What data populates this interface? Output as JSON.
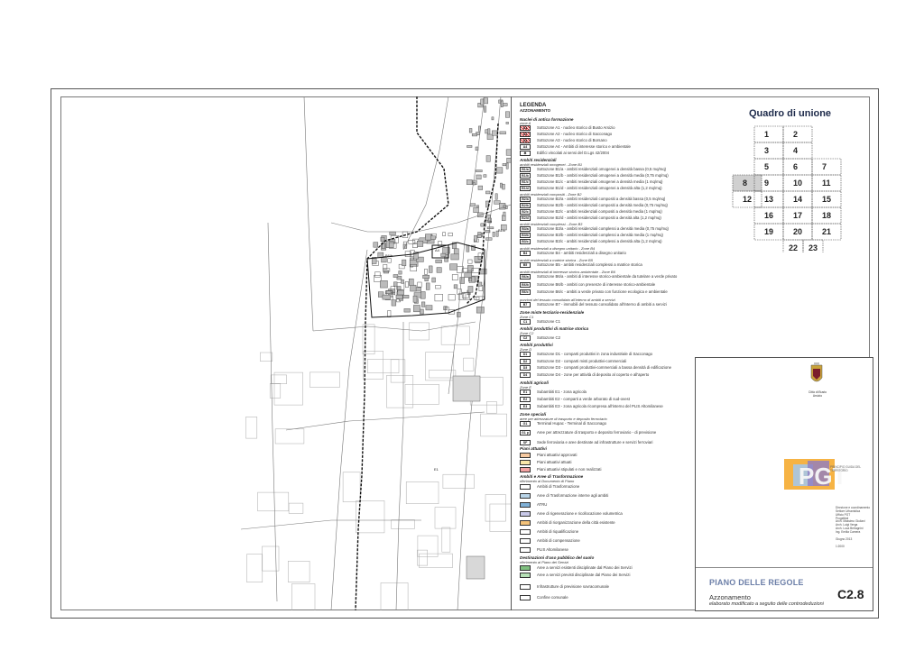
{
  "legend": {
    "title": "LEGENDA",
    "subtitle": "AZZONAMENTO",
    "groups": {
      "nuclei": "Nuclei di antica formazione",
      "zoneA": "zone A",
      "residenziali": "Ambiti residenziali",
      "omogenei": "ambiti residenziali omogenei - Zone B1",
      "compositi": "ambiti residenziali compositi - Zone B2",
      "complessi": "ambiti residenziali complessi - Zone B3",
      "disegno": "ambiti residenziali a disegno unitario - Zone B4",
      "matrice": "ambiti residenziali a matrice storica - Zone B5",
      "interesse": "ambiti residenziali di interesse storico-ambientale - Zone B6",
      "porzioni": "porzioni del tessuto consolidato all'interno di ambiti a servizi",
      "miste": "Zone miste terziario-residenziale",
      "zoneC1": "Zone C1",
      "produttivi_storica": "Ambiti produttivi di matrice storica",
      "zoneC2": "Zone C2",
      "produttivi": "Ambiti produttivi",
      "zoneD": "Zone D",
      "agricoli": "Ambiti agricoli",
      "zoneE": "Zone E",
      "speciali": "Zone speciali",
      "speciali_sub": "aree per attrezzature di trasporto e deposito ferroviario",
      "attuativi": "Piani attuativi",
      "trasformazione": "Ambiti e Aree di Trasformazione",
      "trasf_sub": "riferimento al Documento di Piano",
      "destinazioni": "Destinazioni d'uso pubblico del suolo",
      "dest_sub": "riferimento al Piano dei Servizi"
    },
    "rows": [
      {
        "code": "A1",
        "label": "Sottozone A1 - nucleo storico di Busto Arsizio",
        "color": "#d33"
      },
      {
        "code": "A2",
        "label": "Sottozone A2 - nucleo storico di Sacconago",
        "color": "#d33"
      },
      {
        "code": "A3",
        "label": "Sottozone A3 - nucleo storico di Borsano",
        "color": "#d33"
      },
      {
        "code": "A4",
        "label": "Sottozone A4 - Ambiti di interesse storico e ambientale",
        "color": "#fff"
      },
      {
        "code": "✱",
        "label": "Edifici vincolati ai sensi del D.Lgs 42/2004",
        "color": "#fff"
      },
      {
        "code": "B1/a",
        "label": "Sottozone B1/a - ambiti residenziali omogenei a densità bassa (0,5 mq/mq)",
        "color": "#fff"
      },
      {
        "code": "B1/b",
        "label": "Sottozone B1/b - ambiti residenziali omogenei a densità media (0,75 mq/mq)",
        "color": "#fff"
      },
      {
        "code": "B1/c",
        "label": "Sottozone B1/c - ambiti residenziali omogenei a densità media (1 mq/mq)",
        "color": "#fff"
      },
      {
        "code": "B1/d",
        "label": "Sottozone B1/d - ambiti residenziali omogenei a densità alta (1,2 mq/mq)",
        "color": "#fff"
      },
      {
        "code": "B2/a",
        "label": "Sottozone B2/a - ambiti residenziali compositi a densità bassa (0,5 mq/mq)",
        "color": "#fff"
      },
      {
        "code": "B2/b",
        "label": "Sottozone B2/b - ambiti residenziali compositi a densità media (0,75 mq/mq)",
        "color": "#fff"
      },
      {
        "code": "B2/c",
        "label": "Sottozone B2/c - ambiti residenziali compositi a densità media (1 mq/mq)",
        "color": "#fff"
      },
      {
        "code": "B2/d",
        "label": "Sottozone B2/d - ambiti residenziali compositi a densità alta (1,2 mq/mq)",
        "color": "#fff"
      },
      {
        "code": "B3/a",
        "label": "Sottozone B3/a - ambiti residenziali complessi a densità media (0,75 mq/mq)",
        "color": "#fff"
      },
      {
        "code": "B3/b",
        "label": "Sottozone B3/b - ambiti residenziali complessi a densità media (1 mq/mq)",
        "color": "#fff"
      },
      {
        "code": "B3/c",
        "label": "Sottozone B3/c - ambiti residenziali complessi a densità alta (1,2 mq/mq)",
        "color": "#fff"
      },
      {
        "code": "B4",
        "label": "Sottozone B4 - ambiti residenziali a disegno unitario",
        "color": "#fff"
      },
      {
        "code": "B5",
        "label": "Sottozone B5 - ambiti residenziali complessi a matrice storica",
        "color": "#fff"
      },
      {
        "code": "B6/a",
        "label": "Sottozone B6/a - ambiti di interesse storico-ambientale da tutelare a verde privato",
        "color": "#fff"
      },
      {
        "code": "B6/b",
        "label": "Sottozone B6/b - ambiti con presenze di interesse storico-ambientale",
        "color": "#fff"
      },
      {
        "code": "B6/c",
        "label": "Sottozone B6/c - ambiti a verde privato con funzione ecologica e ambientale",
        "color": "#fff"
      },
      {
        "code": "B7",
        "label": "Sottozone B7 - immobili del tessuto consolidato all'interno di ambiti a servizi",
        "color": "#fff"
      },
      {
        "code": "C1",
        "label": "Sottozone C1",
        "color": "#fff"
      },
      {
        "code": "C2",
        "label": "Sottozone C2",
        "color": "#fff"
      },
      {
        "code": "D1",
        "label": "Sottozone D1 - comparti produttivi in zona industriale di Sacconago",
        "color": "#fff"
      },
      {
        "code": "D2",
        "label": "Sottozone D2 - comparti misti produttivi-commerciali",
        "color": "#fff"
      },
      {
        "code": "D3",
        "label": "Sottozone D3 - comparti produttivi-commerciali a bassa densità di edificazione",
        "color": "#fff"
      },
      {
        "code": "D4",
        "label": "Sottozone D4 - zone per attività di deposito al coperto e all'aperto",
        "color": "#fff"
      },
      {
        "code": "E1",
        "label": "Subambiti E1 - zona agricola",
        "color": "#fff"
      },
      {
        "code": "E2",
        "label": "Subambiti E2 - comparti a verde arborato di sud-ovest",
        "color": "#fff"
      },
      {
        "code": "E3",
        "label": "Subambiti E3 - zona agricola ricompresa all'interno del PLIS Altomilanese",
        "color": "#fff"
      },
      {
        "code": "G1",
        "label": "Terminal Hupac - Terminal di Sacconago",
        "color": "#fff"
      },
      {
        "code": "G1 p",
        "label": "Aree per attrezzature di trasporto e deposito ferroviario - di previsione",
        "color": "#fff"
      },
      {
        "code": "SF",
        "label": "Sede ferroviaria e aree destinate ad infrastrutture e servizi ferroviari",
        "color": "#fff"
      },
      {
        "code": "",
        "label": "Piani attuativi approvati",
        "color": "#f6c9a0"
      },
      {
        "code": "",
        "label": "Piani attuativi attuati",
        "color": "#f8e6a8"
      },
      {
        "code": "",
        "label": "Piani attuativi stipulati e non realizzati",
        "color": "#f4a3a3"
      },
      {
        "code": "",
        "label": "Ambiti di Trasformazione",
        "color": "#fff"
      },
      {
        "code": "",
        "label": "Aree di Trasformazione interne agli ambiti",
        "color": "#b8d4e8"
      },
      {
        "code": "",
        "label": "ATRU",
        "color": "#7fb0d6"
      },
      {
        "code": "",
        "label": "Aree di rigenerazione e ricollocazione volumetrica",
        "color": "#c8c8e8"
      },
      {
        "code": "",
        "label": "Ambiti di riorganizzazione della città esistente",
        "color": "#f3c27a"
      },
      {
        "code": "",
        "label": "Ambiti di riqualificazione",
        "color": "#fff"
      },
      {
        "code": "",
        "label": "Ambiti di compensazione",
        "color": "#fff"
      },
      {
        "code": "",
        "label": "PLIS Altomilanese",
        "color": "#fff"
      },
      {
        "code": "",
        "label": "Aree a servizi esistenti disciplinate dal Piano dei Servizi",
        "color": "#7fbf7f"
      },
      {
        "code": "",
        "label": "Aree a servizi previsti disciplinate dal Piano dei Servizi",
        "color": "#b6e0b6"
      },
      {
        "code": "",
        "label": "Infrastrutture di previsione sovracomunale",
        "color": "#fff"
      },
      {
        "code": "",
        "label": "Confine comunale",
        "color": "#fff"
      }
    ]
  },
  "union": {
    "title": "Quadro di unione",
    "cells": [
      "1",
      "2",
      "3",
      "4",
      "5",
      "6",
      "7",
      "8",
      "9",
      "10",
      "11",
      "12",
      "13",
      "14",
      "15",
      "16",
      "17",
      "18",
      "19",
      "20",
      "21",
      "22",
      "23"
    ]
  },
  "title_block": {
    "town": "Città di Busto Arsizio",
    "pgt_brand": "PGT",
    "pgt_sub": "PRINCIPIO GUIDA DEL TERRITORIO",
    "plan_name": "PIANO DELLE REGOLE",
    "doc_title": "Azzonamento",
    "doc_sub": "elaborato modificato a seguito delle controdeduzioni",
    "code": "C2.8",
    "date": "Giugno 2013",
    "scale": "1:2000",
    "credits": [
      "Direzione e coordinamento",
      "Settore Urbanistica",
      "Ufficio PGT",
      "Progettisti",
      "Arch. Massimo Giuliani",
      "Arch. Luigi Verga",
      "Arch. Luca Bertagnini",
      "Ing. Emilia Carnera"
    ]
  },
  "map": {
    "labels": [
      "B1/b",
      "B1/c",
      "A4",
      "B6/b",
      "E1"
    ]
  }
}
